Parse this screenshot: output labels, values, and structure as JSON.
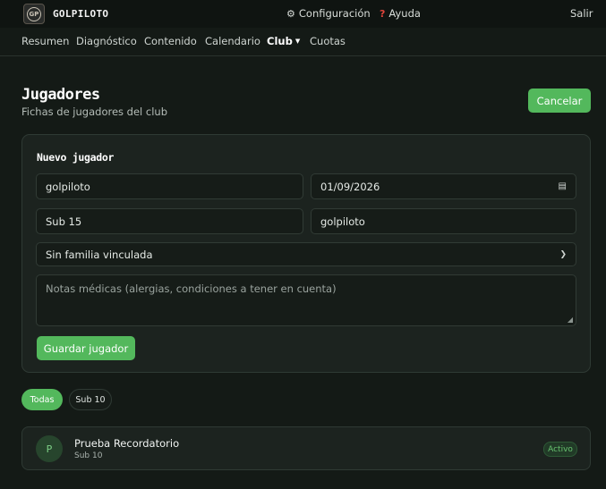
{
  "header": {
    "brand": "GOLPILOTO",
    "logo_text": "GP",
    "settings_label": "Configuración",
    "help_label": "Ayuda",
    "logout_label": "Salir"
  },
  "nav": {
    "items": [
      "Resumen",
      "Diagnóstico",
      "Contenido",
      "Calendario",
      "Club",
      "Cuotas"
    ],
    "active": "Club"
  },
  "page": {
    "title": "Jugadores",
    "subtitle": "Fichas de jugadores del club",
    "cancel_label": "Cancelar"
  },
  "form": {
    "title": "Nuevo jugador",
    "name_value": "golpiloto",
    "date_value": "01/09/2026",
    "category_value": "Sub 15",
    "field4_value": "golpiloto",
    "family_value": "Sin familia vinculada",
    "notes_placeholder": "Notas médicas (alergias, condiciones a tener en cuenta)",
    "save_label": "Guardar jugador"
  },
  "filters": {
    "items": [
      "Todas",
      "Sub 10"
    ],
    "active": "Todas"
  },
  "players": [
    {
      "initial": "P",
      "name": "Prueba Recordatorio",
      "category": "Sub 10",
      "status": "Activo"
    }
  ],
  "colors": {
    "accent": "#53b85c",
    "background": "#141a16",
    "card": "#1c231f",
    "status_active": "#67c26f",
    "help_icon": "#e0443a"
  },
  "icons": {
    "settings": "gear-icon",
    "help": "question-icon",
    "calendar": "calendar-icon",
    "dropdown": "chevron-down-icon"
  }
}
